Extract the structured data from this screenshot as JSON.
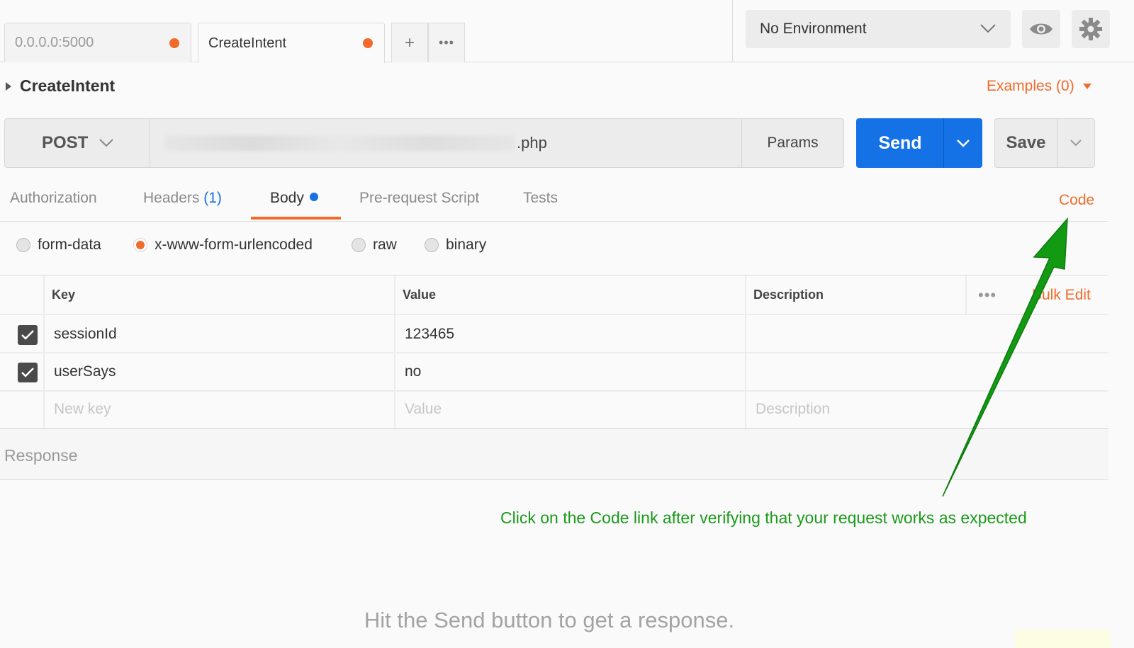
{
  "tabs": [
    {
      "title": "0.0.0.0:5000",
      "unsaved": true
    },
    {
      "title": "CreateIntent",
      "unsaved": true
    }
  ],
  "tab_actions": {
    "add": "+",
    "more": "•••"
  },
  "environment": {
    "selected": "No Environment"
  },
  "request": {
    "name": "CreateIntent",
    "examples": "Examples (0)",
    "method": "POST",
    "url_visible_suffix": ".php",
    "params_label": "Params",
    "send_label": "Send",
    "save_label": "Save"
  },
  "subtabs": {
    "authorization": "Authorization",
    "headers": "Headers",
    "headers_count": "(1)",
    "body": "Body",
    "prerequest": "Pre-request Script",
    "tests": "Tests",
    "code": "Code"
  },
  "body_modes": {
    "form_data": "form-data",
    "urlencoded": "x-www-form-urlencoded",
    "raw": "raw",
    "binary": "binary",
    "selected": "x-www-form-urlencoded"
  },
  "table": {
    "headers": {
      "key": "Key",
      "value": "Value",
      "description": "Description"
    },
    "more": "•••",
    "bulk_edit": "Bulk Edit",
    "rows": [
      {
        "key": "sessionId",
        "value": "123465",
        "checked": true
      },
      {
        "key": "userSays",
        "value": "no",
        "checked": true
      }
    ],
    "placeholders": {
      "key": "New key",
      "value": "Value",
      "description": "Description"
    }
  },
  "response": {
    "label": "Response",
    "hint": "Hit the Send button to get a response."
  },
  "annotation": {
    "text": "Click on the Code link after verifying that your request works as expected",
    "color": "#1a9a1a"
  },
  "colors": {
    "accent": "#f26b2a",
    "primary": "#1571e6"
  }
}
